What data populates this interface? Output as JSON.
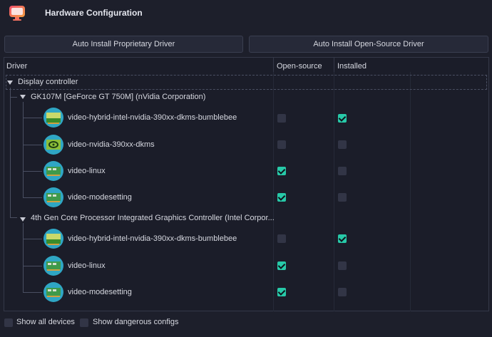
{
  "window": {
    "title": "Hardware Configuration"
  },
  "buttons": {
    "proprietary": "Auto Install Proprietary Driver",
    "open_source": "Auto Install Open-Source Driver"
  },
  "columns": {
    "driver": "Driver",
    "open_source": "Open-source",
    "installed": "Installed"
  },
  "tree": {
    "category": "Display controller",
    "devices": [
      {
        "name": "GK107M [GeForce GT 750M] (nVidia Corporation)",
        "drivers": [
          {
            "name": "video-hybrid-intel-nvidia-390xx-dkms-bumblebee",
            "icon": "nvidia-hybrid-card-icon",
            "open_source": false,
            "installed": true
          },
          {
            "name": "video-nvidia-390xx-dkms",
            "icon": "nvidia-card-icon",
            "open_source": false,
            "installed": false
          },
          {
            "name": "video-linux",
            "icon": "graphics-card-icon",
            "open_source": true,
            "installed": false
          },
          {
            "name": "video-modesetting",
            "icon": "graphics-card-icon",
            "open_source": true,
            "installed": false
          }
        ]
      },
      {
        "name": "4th Gen Core Processor Integrated Graphics Controller (Intel Corpor...",
        "drivers": [
          {
            "name": "video-hybrid-intel-nvidia-390xx-dkms-bumblebee",
            "icon": "nvidia-hybrid-card-icon",
            "open_source": false,
            "installed": true
          },
          {
            "name": "video-linux",
            "icon": "graphics-card-icon",
            "open_source": true,
            "installed": false
          },
          {
            "name": "video-modesetting",
            "icon": "graphics-card-icon",
            "open_source": true,
            "installed": false
          }
        ]
      }
    ]
  },
  "footer": {
    "show_all_devices": "Show all devices",
    "show_dangerous": "Show dangerous configs"
  },
  "colors": {
    "accent": "#27c9a8",
    "background": "#1d1f2b",
    "icon_bg": "#2fa6c4"
  }
}
